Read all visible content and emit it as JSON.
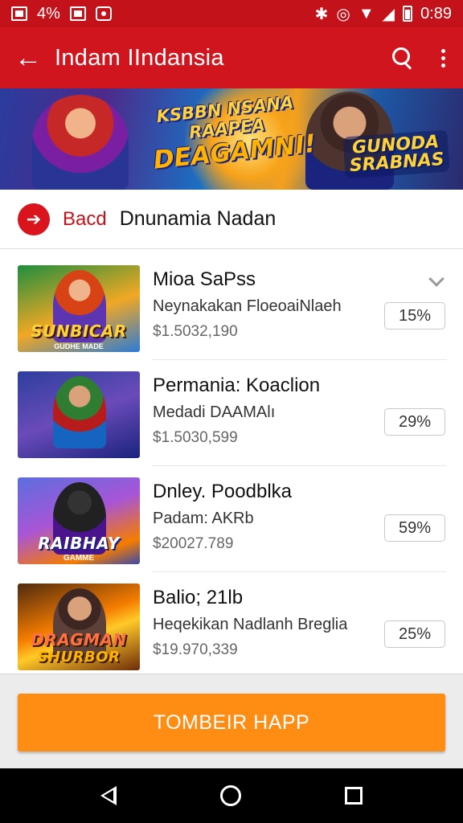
{
  "status_bar": {
    "left_text": "4%",
    "time": "0:89"
  },
  "app_bar": {
    "title": "Indam IIndansia",
    "back_icon": "arrow-back-icon",
    "search_icon": "search-icon",
    "more_icon": "more-vert-icon"
  },
  "banner": {
    "headline_top": "KSBBN NSANA",
    "headline_mid": "RAAPEA",
    "headline_big": "DEAGAMNI!",
    "brand_line1": "GUNODA",
    "brand_line2": "SRABNAS"
  },
  "section": {
    "label": "Bacd",
    "title": "Dnunamia Nadan"
  },
  "items": [
    {
      "name": "Mioa SaPss",
      "subtitle": "Neynakakan FloeoaiNlaeh",
      "price": "$1.5032,190",
      "percent": "15%",
      "thumb_caption": "SUNBICAR",
      "thumb_sub": "GUDHE MADE"
    },
    {
      "name": "Permania: Koaclion",
      "subtitle": "Medadi DAAMAlı",
      "price": "$1.5030,599",
      "percent": "29%",
      "thumb_caption": "",
      "thumb_sub": ""
    },
    {
      "name": "Dnley. Poodblka",
      "subtitle": "Padam: AKRb",
      "price": "$20027.789",
      "percent": "59%",
      "thumb_caption": "RAIBHAY",
      "thumb_sub": "GAMME"
    },
    {
      "name": "Balio; 21lb",
      "subtitle": "Heqekikan Nadlanh Breglia",
      "price": "$19.970,339",
      "percent": "25%",
      "thumb_caption": "DRAGMAN",
      "thumb_sub": "SHURBOR"
    }
  ],
  "cta": {
    "label": "TOMBEIR HAPP"
  },
  "colors": {
    "primary": "#d0151e",
    "accent": "#ff8c13"
  }
}
